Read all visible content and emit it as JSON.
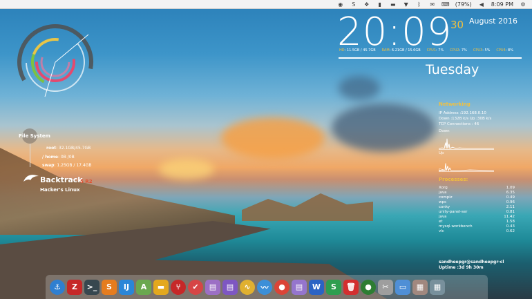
{
  "top_panel": {
    "battery": "(79%)",
    "time": "8:09 PM",
    "icons": [
      "chrome-icon",
      "skype-icon",
      "dropbox-icon",
      "battery-indicator-icon",
      "folder-icon",
      "wifi-icon",
      "bluetooth-icon",
      "mail-icon",
      "keyboard-icon",
      "battery-icon",
      "volume-icon",
      "settings-icon"
    ]
  },
  "clock": {
    "time": "20:09",
    "seconds": "30",
    "date": "August 2016",
    "day": "Tuesday"
  },
  "stats": [
    {
      "label": "HD",
      "value": ": 11.5GB / 45.7GB"
    },
    {
      "label": "RAM",
      "value": ": 6.21GB / 15.6GB"
    },
    {
      "label": "CPU1",
      "value": ": 7%"
    },
    {
      "label": "CPU2",
      "value": ": 7%"
    },
    {
      "label": "CPU3",
      "value": ": 5%"
    },
    {
      "label": "CPU4",
      "value": ": 8%"
    }
  ],
  "filesystem": {
    "title": "File System",
    "root": {
      "key": "root",
      "value": ": 32.1GB/45.7GB"
    },
    "home": {
      "key": "/ home",
      "value": ": 0B /0B"
    },
    "swap": {
      "key": "swap",
      "value": ": 1.25GB / 17.4GB"
    }
  },
  "distro": {
    "name": "Backtrack",
    "version": "5 R2",
    "subtitle": "Hacker's Linux"
  },
  "networking": {
    "title": "Networking",
    "ip": "IP Address :192.168.0.10",
    "down_up": "Down :132B  k/s   Up :30B  k/s",
    "tcp": "TCP Connections : 46",
    "down_label": "Down",
    "up_label": "Up",
    "down2_label": "Do"
  },
  "processes": {
    "title": "Processes:",
    "rows": [
      {
        "name": "Xorg",
        "value": "1.09"
      },
      {
        "name": "java",
        "value": "6.35"
      },
      {
        "name": "compiz",
        "value": "0.49"
      },
      {
        "name": "wps",
        "value": "0.96"
      },
      {
        "name": "conky",
        "value": "2.11"
      },
      {
        "name": "unity-panel-ser",
        "value": "0.81"
      },
      {
        "name": "java",
        "value": "11.42"
      },
      {
        "name": "et",
        "value": "1.58"
      },
      {
        "name": "mysql-workbench",
        "value": "0.43"
      },
      {
        "name": "vlc",
        "value": "0.62"
      }
    ]
  },
  "user": {
    "host": "sandheepgr@sandheepgr-cl",
    "uptime": "Uptime :3d 9h 30m"
  },
  "dock": [
    {
      "name": "anchor-icon",
      "glyph": "⚓",
      "color": "#2f7fd0",
      "round": true
    },
    {
      "name": "filezilla-icon",
      "glyph": "Z",
      "color": "#c62828",
      "round": false
    },
    {
      "name": "terminal-icon",
      "glyph": ">_",
      "color": "#37474f",
      "round": false
    },
    {
      "name": "sublime-icon",
      "glyph": "S",
      "color": "#e57c1e",
      "round": false
    },
    {
      "name": "intellij-icon",
      "glyph": "IJ",
      "color": "#2a86d8",
      "round": false
    },
    {
      "name": "android-studio-icon",
      "glyph": "A",
      "color": "#6aa84f",
      "round": false
    },
    {
      "name": "files-icon",
      "glyph": "▬",
      "color": "#e3a81e",
      "round": false
    },
    {
      "name": "git-icon",
      "glyph": "⑂",
      "color": "#c62828",
      "round": true
    },
    {
      "name": "todo-icon",
      "glyph": "✔",
      "color": "#d64545",
      "round": true
    },
    {
      "name": "writer-icon",
      "glyph": "▤",
      "color": "#9c6fc5",
      "round": false
    },
    {
      "name": "document-icon",
      "glyph": "▤",
      "color": "#7e57c2",
      "round": false
    },
    {
      "name": "curve-tool-icon",
      "glyph": "∿",
      "color": "#e0b030",
      "round": true
    },
    {
      "name": "mustache-icon",
      "glyph": "〰",
      "color": "#3c8fd8",
      "round": true
    },
    {
      "name": "chrome-icon",
      "glyph": "●",
      "color": "#db4437",
      "round": true
    },
    {
      "name": "text-editor-icon",
      "glyph": "▤",
      "color": "#9575cd",
      "round": false
    },
    {
      "name": "wps-writer-icon",
      "glyph": "W",
      "color": "#2b63c4",
      "round": false
    },
    {
      "name": "wps-spreadsheet-icon",
      "glyph": "S",
      "color": "#2e9e4f",
      "round": false
    },
    {
      "name": "trash-icon",
      "glyph": "🗑",
      "color": "#d32f2f",
      "round": false
    },
    {
      "name": "green-circle-icon",
      "glyph": "●",
      "color": "#2e7d32",
      "round": true
    },
    {
      "name": "screenshot-scissors-icon",
      "glyph": "✂",
      "color": "#9e9e9e",
      "round": false
    },
    {
      "name": "window-icon",
      "glyph": "▭",
      "color": "#4f8fd6",
      "round": false
    },
    {
      "name": "photo-icon",
      "glyph": "▦",
      "color": "#a1887f",
      "round": false
    },
    {
      "name": "workspace-switcher-icon",
      "glyph": "▦",
      "color": "#78909c",
      "round": false
    }
  ]
}
